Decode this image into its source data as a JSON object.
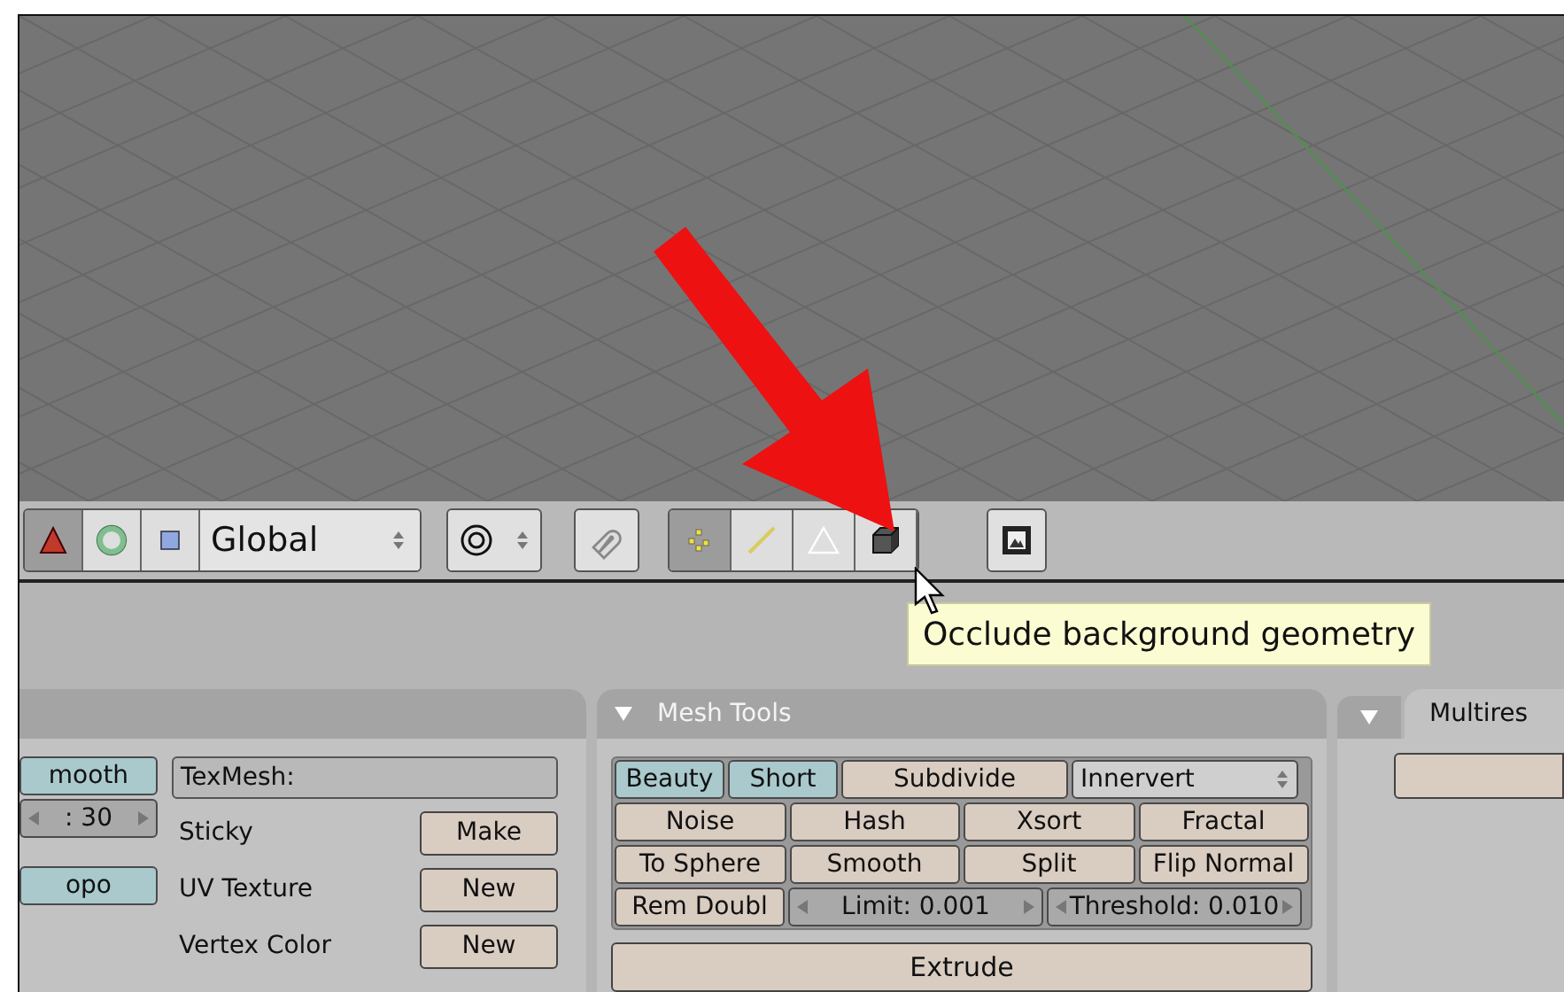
{
  "toolbar": {
    "transform_buttons": [
      {
        "kind": "translate",
        "selected": true
      },
      {
        "kind": "rotate",
        "selected": false
      },
      {
        "kind": "scale",
        "selected": false
      }
    ],
    "orientation": {
      "value": "Global"
    },
    "select_modes": [
      {
        "kind": "vertex",
        "selected": true
      },
      {
        "kind": "edge",
        "selected": false
      },
      {
        "kind": "face",
        "selected": false
      },
      {
        "kind": "occlude",
        "selected": false
      }
    ]
  },
  "tooltip": {
    "text": "Occlude background geometry"
  },
  "left_panel": {
    "column_1": [
      {
        "kind": "toggle",
        "label": "mooth",
        "on": true
      },
      {
        "kind": "number",
        "label": ": 30"
      },
      {
        "kind": "toggle",
        "label": "opo",
        "on": true
      }
    ],
    "texmesh": {
      "value": "TexMesh:"
    },
    "rows": [
      {
        "label": "Sticky",
        "button": "Make"
      },
      {
        "label": "UV Texture",
        "button": "New"
      },
      {
        "label": "Vertex Color",
        "button": "New"
      }
    ]
  },
  "mesh_tools": {
    "title": "Mesh Tools",
    "expanded": true,
    "subdivide_options": [
      {
        "kind": "toggle",
        "label": "Beauty",
        "on": true
      },
      {
        "kind": "toggle",
        "label": "Short",
        "on": true
      },
      {
        "kind": "button",
        "label": "Subdivide"
      },
      {
        "kind": "dropdown",
        "label": "Innervert"
      }
    ],
    "tool_buttons": [
      {
        "kind": "button",
        "label": "Noise"
      },
      {
        "kind": "button",
        "label": "Hash"
      },
      {
        "kind": "button",
        "label": "Xsort"
      },
      {
        "kind": "button",
        "label": "Fractal"
      },
      {
        "kind": "button",
        "label": "To Sphere"
      },
      {
        "kind": "button",
        "label": "Smooth"
      },
      {
        "kind": "button",
        "label": "Split"
      },
      {
        "kind": "button",
        "label": "Flip Normal"
      }
    ],
    "remove_doubles": [
      {
        "kind": "button",
        "label": "Rem Doubl"
      },
      {
        "kind": "number",
        "label": "Limit: 0.001"
      },
      {
        "kind": "number",
        "label": "Threshold: 0.010"
      }
    ],
    "extrude": "Extrude"
  },
  "multires": {
    "title": "Multires",
    "expanded": true
  }
}
